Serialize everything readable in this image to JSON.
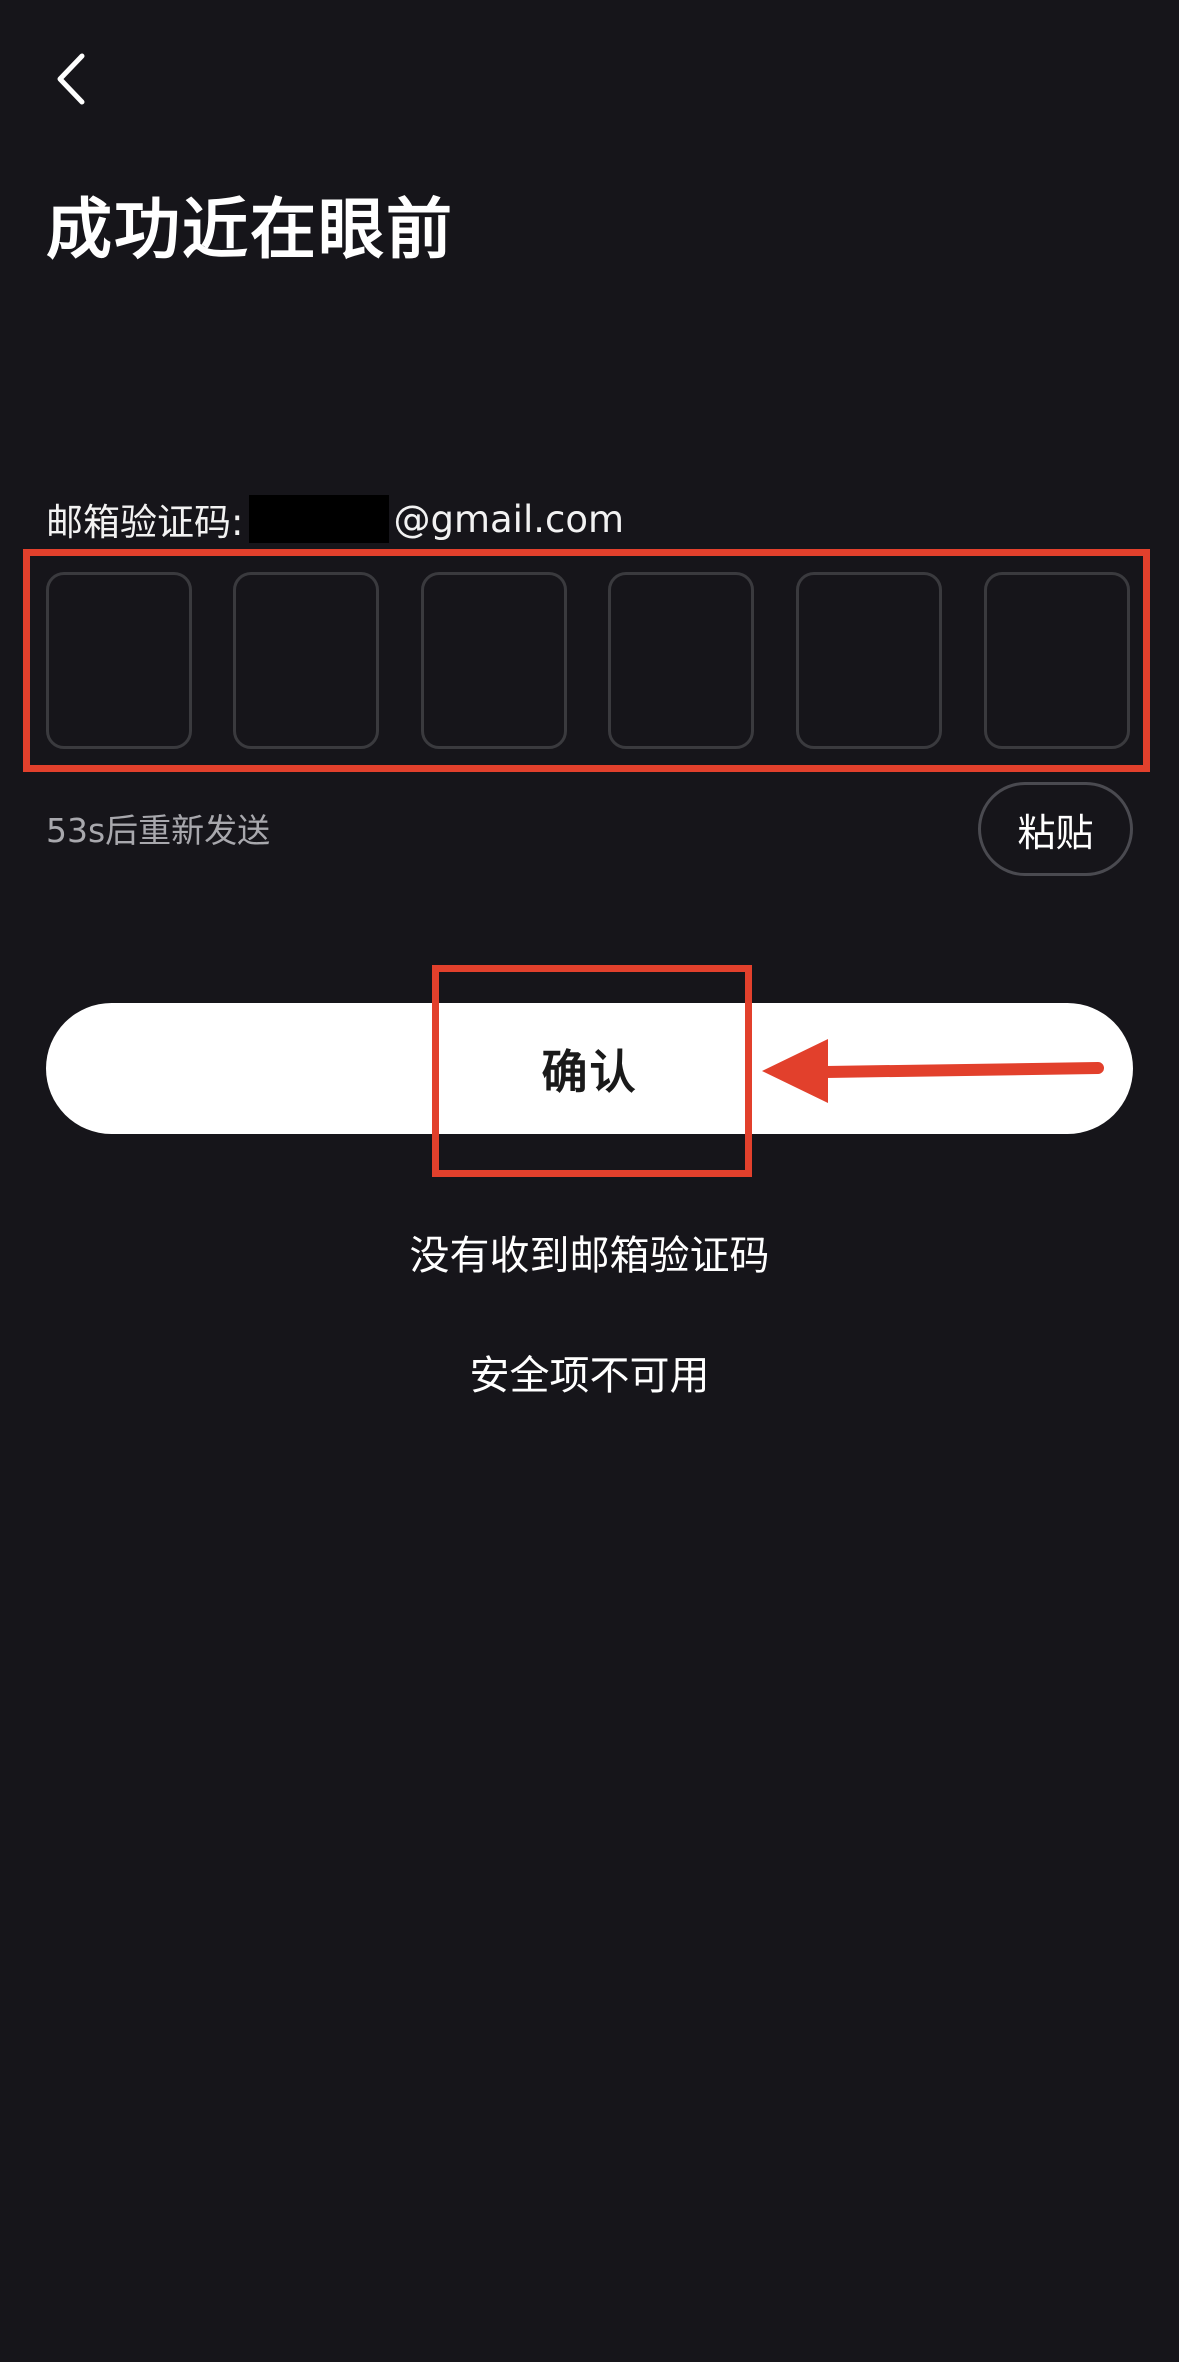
{
  "header": {
    "back_icon": "chevron-left-icon",
    "title": "成功近在眼前"
  },
  "email": {
    "label": "邮箱验证码:",
    "domain": "@gmail.com"
  },
  "code": {
    "length": 6
  },
  "resend": {
    "text": "53s后重新发送"
  },
  "paste": {
    "label": "粘贴"
  },
  "confirm": {
    "label": "确认"
  },
  "links": {
    "no_code": "没有收到邮箱验证码",
    "security_unavailable": "安全项不可用"
  },
  "colors": {
    "background": "#16151a",
    "annotation": "#e2402c",
    "button": "#ffffff"
  }
}
